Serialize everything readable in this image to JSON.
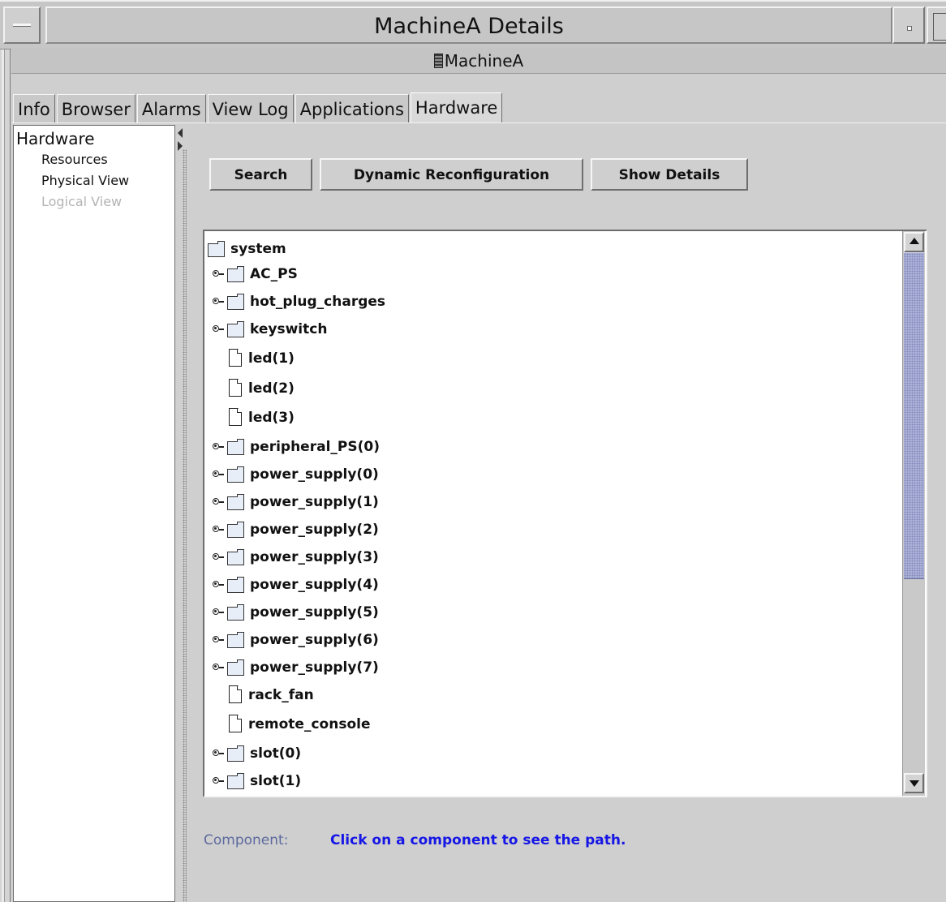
{
  "window": {
    "title": "MachineA Details"
  },
  "header": {
    "machine_name": "MachineA"
  },
  "tabs": [
    {
      "label": "Info",
      "active": false
    },
    {
      "label": "Browser",
      "active": false
    },
    {
      "label": "Alarms",
      "active": false
    },
    {
      "label": "View Log",
      "active": false
    },
    {
      "label": "Applications",
      "active": false
    },
    {
      "label": "Hardware",
      "active": true
    }
  ],
  "nav": {
    "root": "Hardware",
    "items": [
      {
        "label": "Resources",
        "enabled": true
      },
      {
        "label": "Physical View",
        "enabled": true
      },
      {
        "label": "Logical View",
        "enabled": false
      }
    ]
  },
  "toolbar": {
    "search_label": "Search",
    "dynamic_reconfig_label": "Dynamic Reconfiguration",
    "show_details_label": "Show Details"
  },
  "tree": {
    "root": {
      "label": "system",
      "type": "folder"
    },
    "children": [
      {
        "label": "AC_PS",
        "type": "folder",
        "expandable": true
      },
      {
        "label": "hot_plug_charges",
        "type": "folder",
        "expandable": true
      },
      {
        "label": "keyswitch",
        "type": "folder",
        "expandable": true
      },
      {
        "label": "led(1)",
        "type": "leaf",
        "expandable": false
      },
      {
        "label": "led(2)",
        "type": "leaf",
        "expandable": false
      },
      {
        "label": "led(3)",
        "type": "leaf",
        "expandable": false
      },
      {
        "label": "peripheral_PS(0)",
        "type": "folder",
        "expandable": true
      },
      {
        "label": "power_supply(0)",
        "type": "folder",
        "expandable": true
      },
      {
        "label": "power_supply(1)",
        "type": "folder",
        "expandable": true
      },
      {
        "label": "power_supply(2)",
        "type": "folder",
        "expandable": true
      },
      {
        "label": "power_supply(3)",
        "type": "folder",
        "expandable": true
      },
      {
        "label": "power_supply(4)",
        "type": "folder",
        "expandable": true
      },
      {
        "label": "power_supply(5)",
        "type": "folder",
        "expandable": true
      },
      {
        "label": "power_supply(6)",
        "type": "folder",
        "expandable": true
      },
      {
        "label": "power_supply(7)",
        "type": "folder",
        "expandable": true
      },
      {
        "label": "rack_fan",
        "type": "leaf",
        "expandable": false
      },
      {
        "label": "remote_console",
        "type": "leaf",
        "expandable": false
      },
      {
        "label": "slot(0)",
        "type": "folder",
        "expandable": true
      },
      {
        "label": "slot(1)",
        "type": "folder",
        "expandable": true
      }
    ]
  },
  "component": {
    "label": "Component:",
    "text": "Click on a component to see the path."
  },
  "colors": {
    "window_bg": "#cfcfcf",
    "scroll_thumb": "#aab0d6",
    "component_label": "#5d6a9e",
    "component_text": "#1616e6",
    "disabled_text": "#b4b4b4"
  }
}
